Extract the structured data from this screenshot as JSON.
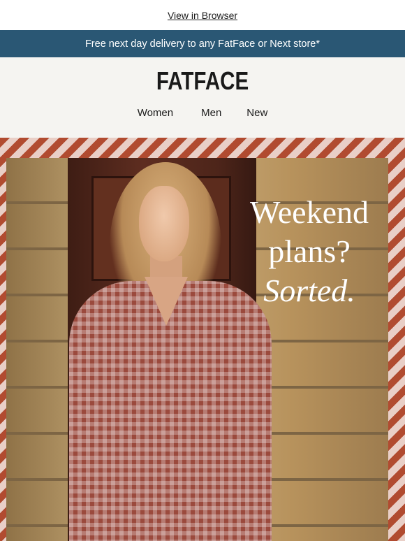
{
  "topbar": {
    "view_in_browser": "View in Browser"
  },
  "promo": {
    "text": "Free next day delivery to any FatFace or Next store*",
    "background": "#2a5774"
  },
  "header": {
    "logo": "FATFACE",
    "nav": [
      "Women",
      "Men",
      "New"
    ]
  },
  "hero": {
    "headline_line1": "Weekend",
    "headline_line2": "plans?",
    "headline_line3": "Sorted.",
    "border_colors": [
      "#b14b30",
      "#e9cfc7"
    ]
  }
}
